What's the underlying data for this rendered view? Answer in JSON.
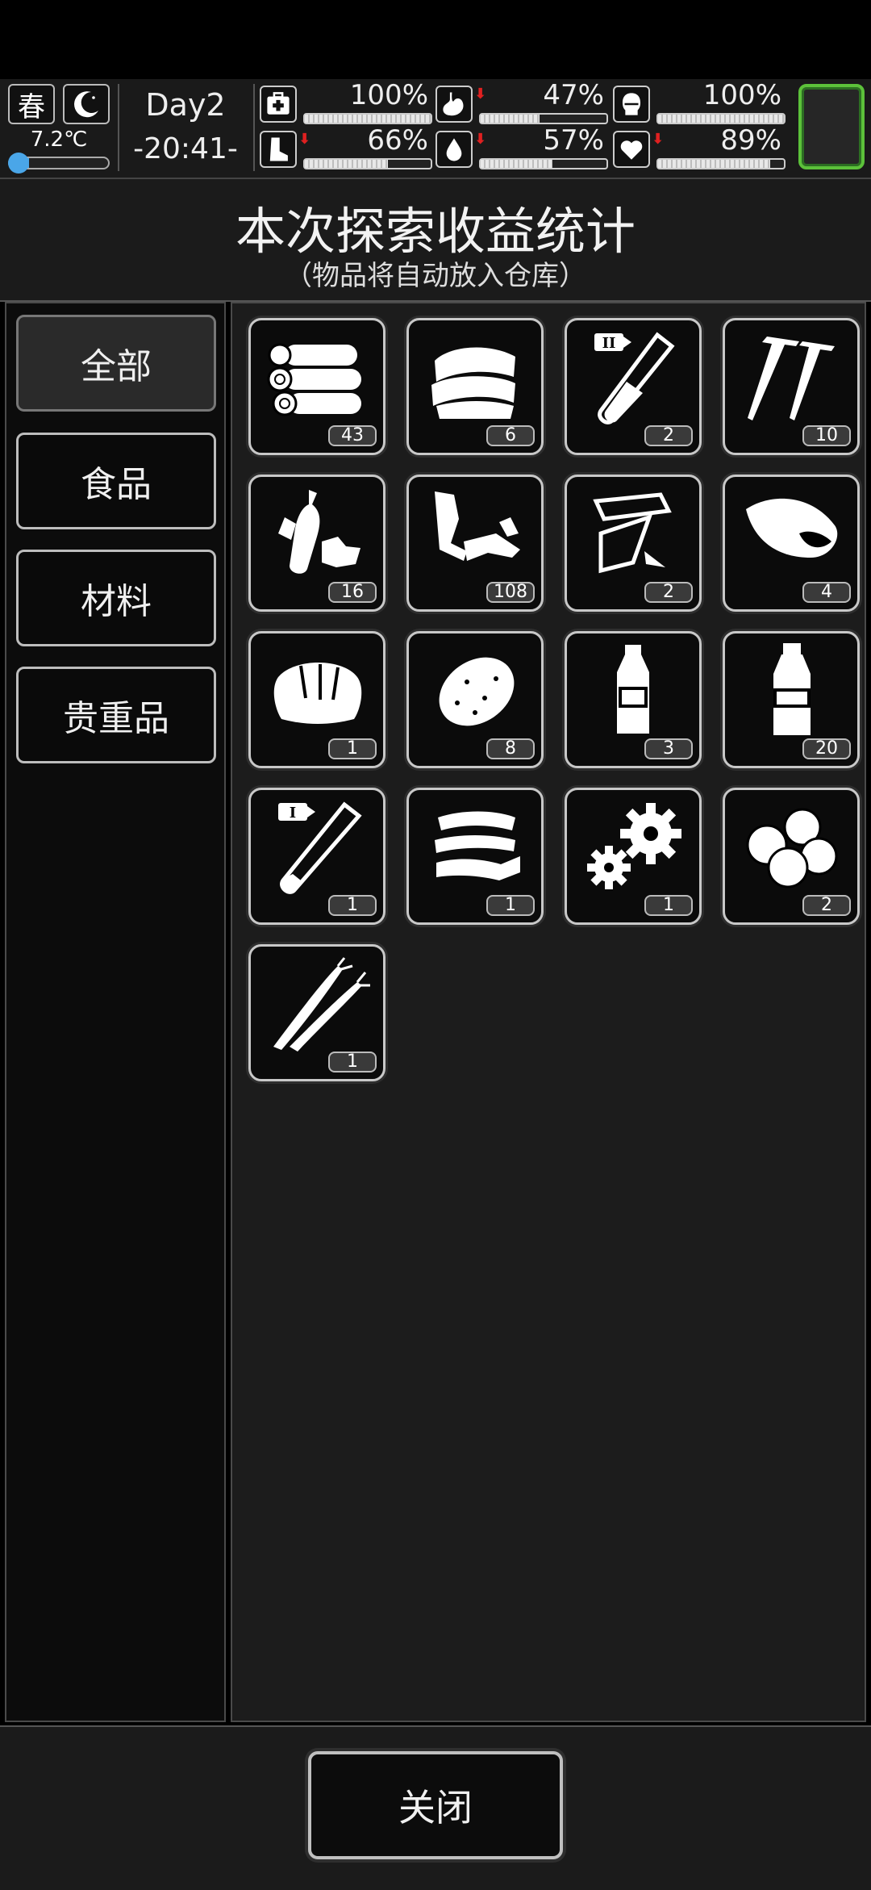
{
  "status": {
    "season": "春",
    "temperature": "7.2℃",
    "temperature_level": 0.2,
    "day": "Day2",
    "time": "-20:41-",
    "stats": [
      {
        "name": "health",
        "icon": "first-aid-icon",
        "value": "100%",
        "level": 1.0,
        "decreasing": false
      },
      {
        "name": "hunger",
        "icon": "stomach-icon",
        "value": "47%",
        "level": 0.47,
        "decreasing": true
      },
      {
        "name": "mental",
        "icon": "head-icon",
        "value": "100%",
        "level": 1.0,
        "decreasing": false
      },
      {
        "name": "stamina",
        "icon": "boot-icon",
        "value": "66%",
        "level": 0.66,
        "decreasing": true
      },
      {
        "name": "thirst",
        "icon": "water-drop-icon",
        "value": "57%",
        "level": 0.57,
        "decreasing": true
      },
      {
        "name": "mood",
        "icon": "heart-icon",
        "value": "89%",
        "level": 0.89,
        "decreasing": true
      }
    ]
  },
  "header": {
    "title": "本次探索收益统计",
    "subtitle": "（物品将自动放入仓库）"
  },
  "tabs": [
    {
      "label": "全部",
      "active": true
    },
    {
      "label": "食品",
      "active": false
    },
    {
      "label": "材料",
      "active": false
    },
    {
      "label": "贵重品",
      "active": false
    }
  ],
  "items": [
    {
      "icon": "logs-icon",
      "count": "43"
    },
    {
      "icon": "cloth-icon",
      "count": "6"
    },
    {
      "icon": "test-tube-2-icon",
      "count": "2"
    },
    {
      "icon": "nails-icon",
      "count": "10"
    },
    {
      "icon": "plastic-bottles-icon",
      "count": "16"
    },
    {
      "icon": "scrap-metal-icon",
      "count": "108"
    },
    {
      "icon": "paper-icon",
      "count": "2"
    },
    {
      "icon": "sweet-potato-icon",
      "count": "4"
    },
    {
      "icon": "bread-icon",
      "count": "1"
    },
    {
      "icon": "potato-icon",
      "count": "8"
    },
    {
      "icon": "small-bottle-icon",
      "count": "3"
    },
    {
      "icon": "water-bottle-icon",
      "count": "20"
    },
    {
      "icon": "test-tube-1-icon",
      "count": "1"
    },
    {
      "icon": "tape-roll-icon",
      "count": "1"
    },
    {
      "icon": "gears-icon",
      "count": "1"
    },
    {
      "icon": "buns-icon",
      "count": "2"
    },
    {
      "icon": "scallion-icon",
      "count": "1"
    }
  ],
  "footer": {
    "close_label": "关闭"
  },
  "colors": {
    "accent_green": "#5cc13a",
    "temp_blue": "#4aa6e8",
    "down_arrow": "#e02020"
  }
}
